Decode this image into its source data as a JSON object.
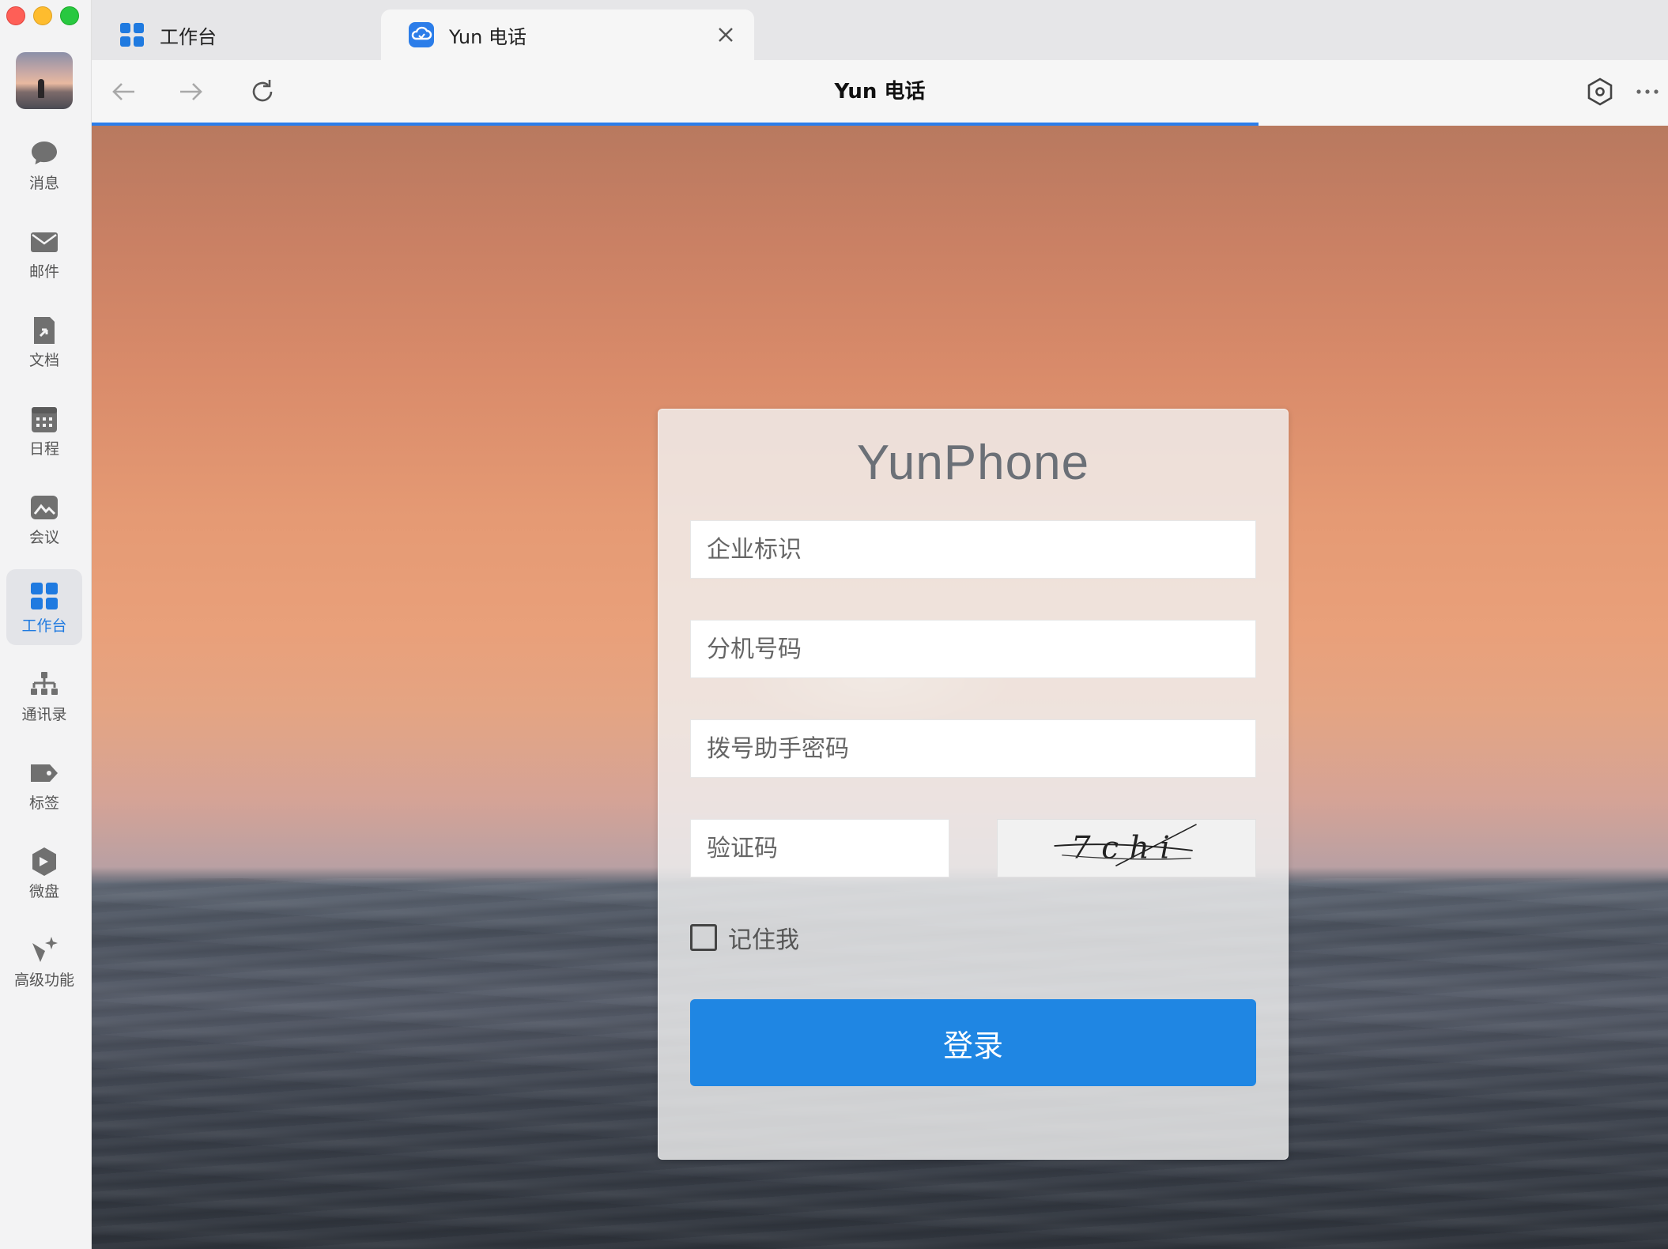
{
  "window": {
    "title": "Yun 电话",
    "load_progress_percent": 74
  },
  "sidebar": {
    "avatar_alt": "",
    "items": [
      {
        "id": "messages",
        "label": "消息",
        "icon": "chat-bubble-icon",
        "active": false
      },
      {
        "id": "mail",
        "label": "邮件",
        "icon": "mail-icon",
        "active": false
      },
      {
        "id": "docs",
        "label": "文档",
        "icon": "document-icon",
        "active": false
      },
      {
        "id": "calendar",
        "label": "日程",
        "icon": "calendar-icon",
        "active": false
      },
      {
        "id": "meeting",
        "label": "会议",
        "icon": "meeting-icon",
        "active": false
      },
      {
        "id": "workbench",
        "label": "工作台",
        "icon": "grid-icon",
        "active": true
      },
      {
        "id": "contacts",
        "label": "通讯录",
        "icon": "org-chart-icon",
        "active": false
      },
      {
        "id": "tags",
        "label": "标签",
        "icon": "tag-icon",
        "active": false
      },
      {
        "id": "drive",
        "label": "微盘",
        "icon": "cloud-drive-icon",
        "active": false
      },
      {
        "id": "advanced",
        "label": "高级功能",
        "icon": "sparkle-icon",
        "active": false
      }
    ]
  },
  "tabs": [
    {
      "label": "工作台",
      "icon": "grid-icon",
      "active": false
    },
    {
      "label": "Yun 电话",
      "icon": "cloud-phone-icon",
      "active": true
    }
  ],
  "login": {
    "brand": "YunPhone",
    "fields": {
      "enterprise_id": {
        "placeholder": "企业标识",
        "value": ""
      },
      "extension": {
        "placeholder": "分机号码",
        "value": ""
      },
      "password": {
        "placeholder": "拨号助手密码",
        "value": ""
      },
      "captcha": {
        "placeholder": "验证码",
        "value": ""
      }
    },
    "captcha_text": "7chi",
    "remember_label": "记住我",
    "remember_checked": false,
    "submit_label": "登录"
  },
  "colors": {
    "accent": "#1f86e3",
    "progress": "#2b7de9",
    "active_nav": "#1f7ae0"
  }
}
